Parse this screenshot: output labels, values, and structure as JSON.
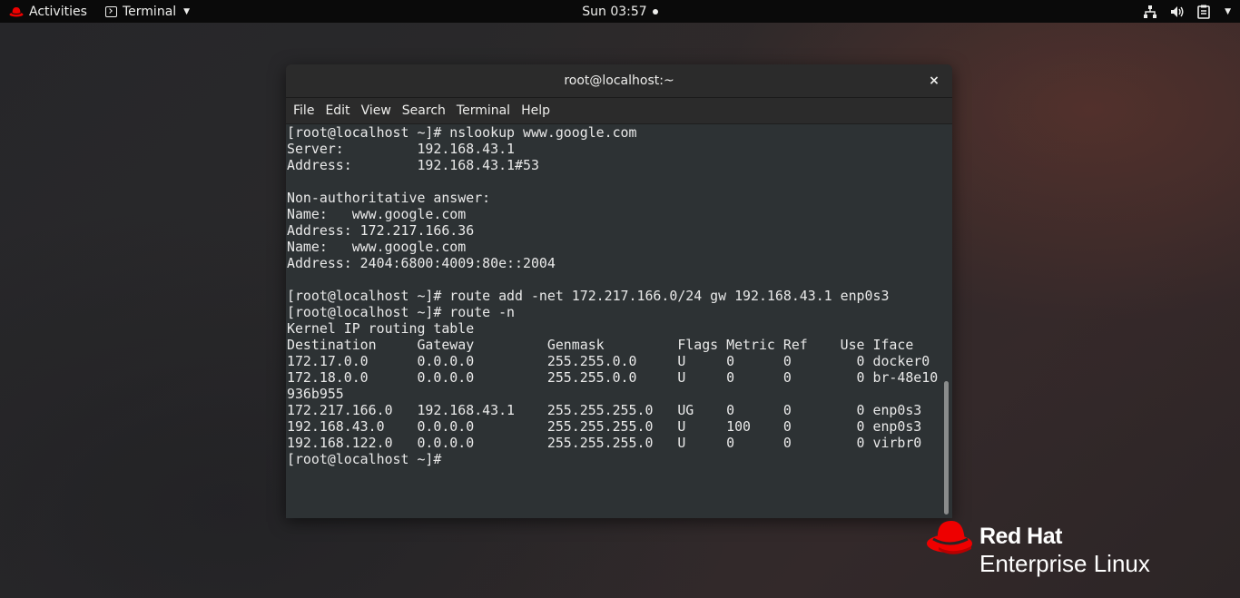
{
  "topbar": {
    "activities_label": "Activities",
    "app_menu_label": "Terminal",
    "clock": "Sun 03:57",
    "icons": [
      "network-icon",
      "volume-icon",
      "clipboard-icon",
      "chevron-down-icon"
    ]
  },
  "window": {
    "title": "root@localhost:~",
    "close_label": "×",
    "menu": [
      "File",
      "Edit",
      "View",
      "Search",
      "Terminal",
      "Help"
    ]
  },
  "terminal": {
    "lines": [
      "[root@localhost ~]# nslookup www.google.com",
      "Server:         192.168.43.1",
      "Address:        192.168.43.1#53",
      "",
      "Non-authoritative answer:",
      "Name:   www.google.com",
      "Address: 172.217.166.36",
      "Name:   www.google.com",
      "Address: 2404:6800:4009:80e::2004",
      "",
      "[root@localhost ~]# route add -net 172.217.166.0/24 gw 192.168.43.1 enp0s3",
      "[root@localhost ~]# route -n",
      "Kernel IP routing table",
      "Destination     Gateway         Genmask         Flags Metric Ref    Use Iface",
      "172.17.0.0      0.0.0.0         255.255.0.0     U     0      0        0 docker0",
      "172.18.0.0      0.0.0.0         255.255.0.0     U     0      0        0 br-48e10",
      "936b955",
      "172.217.166.0   192.168.43.1    255.255.255.0   UG    0      0        0 enp0s3",
      "192.168.43.0    0.0.0.0         255.255.255.0   U     100    0        0 enp0s3",
      "192.168.122.0   0.0.0.0         255.255.255.0   U     0      0        0 virbr0",
      "[root@localhost ~]#"
    ]
  },
  "logo": {
    "line1": "Red Hat",
    "line2": "Enterprise Linux",
    "color": "#ee0000"
  }
}
